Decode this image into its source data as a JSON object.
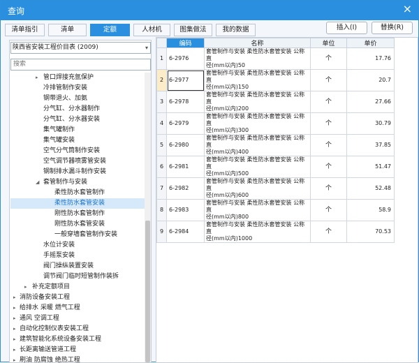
{
  "window": {
    "title": "查询",
    "close_glyph": "×"
  },
  "tabs": [
    {
      "label": "清单指引"
    },
    {
      "label": "清单"
    },
    {
      "label": "定额"
    },
    {
      "label": "人材机"
    },
    {
      "label": "图集做法"
    },
    {
      "label": "我的数据"
    }
  ],
  "active_tab": "定额",
  "buttons": {
    "insert": "插入(I)",
    "replace": "替换(R)"
  },
  "left": {
    "library_select": "陕西省安装工程价目表 (2009)",
    "search_placeholder": "搜索",
    "tree": [
      {
        "label": "管口焊接充氩保护",
        "level": 3,
        "expander": "▸"
      },
      {
        "label": "冷排管制作安装",
        "level": 3,
        "expander": ""
      },
      {
        "label": "钢带退火、加氨",
        "level": 3,
        "expander": ""
      },
      {
        "label": "分气缸、分水器制作",
        "level": 3,
        "expander": ""
      },
      {
        "label": "分气缸、分水器安装",
        "level": 3,
        "expander": ""
      },
      {
        "label": "集气罐制作",
        "level": 3,
        "expander": ""
      },
      {
        "label": "集气罐安装",
        "level": 3,
        "expander": ""
      },
      {
        "label": "空气分气筒制作安装",
        "level": 3,
        "expander": ""
      },
      {
        "label": "空气调节器喷雾管安装",
        "level": 3,
        "expander": ""
      },
      {
        "label": "钢制排水漏斗制作安装",
        "level": 3,
        "expander": ""
      },
      {
        "label": "套管制作与安装",
        "level": 3,
        "expander": "◢"
      },
      {
        "label": "柔性防水套管制作",
        "level": 4,
        "expander": ""
      },
      {
        "label": "柔性防水套管安装",
        "level": 4,
        "expander": "",
        "selected": true
      },
      {
        "label": "刚性防水套管制作",
        "level": 4,
        "expander": ""
      },
      {
        "label": "刚性防水套管安装",
        "level": 4,
        "expander": ""
      },
      {
        "label": "一般穿墙套管制作安装",
        "level": 4,
        "expander": ""
      },
      {
        "label": "水位计安装",
        "level": 3,
        "expander": ""
      },
      {
        "label": "手摇泵安装",
        "level": 3,
        "expander": ""
      },
      {
        "label": "阀门操纵装置安装",
        "level": 3,
        "expander": ""
      },
      {
        "label": "调节阀门临时短管制作装拆",
        "level": 3,
        "expander": ""
      },
      {
        "label": "补充定额项目",
        "level": 2,
        "expander": "▸"
      },
      {
        "label": "消防设备安装工程",
        "level": 1,
        "expander": "▸"
      },
      {
        "label": "给排水 采暖 燃气工程",
        "level": 1,
        "expander": "▸"
      },
      {
        "label": "通风 空调工程",
        "level": 1,
        "expander": "▸"
      },
      {
        "label": "自动化控制仪表安装工程",
        "level": 1,
        "expander": "▸"
      },
      {
        "label": "建筑智能化系统设备安装工程",
        "level": 1,
        "expander": "▸"
      },
      {
        "label": "长距离输送管道工程",
        "level": 1,
        "expander": "▸"
      },
      {
        "label": "刷油 防腐蚀 绝热工程",
        "level": 1,
        "expander": "▸"
      }
    ]
  },
  "grid": {
    "headers": {
      "idx": "",
      "code": "编码",
      "name": "名称",
      "unit": "单位",
      "price": "单价"
    },
    "rows": [
      {
        "idx": "1",
        "code": "6-2976",
        "name1": "套管制作与安装 柔性防水套管安装 公称直",
        "name2": "径(mm以内)50",
        "unit": "个",
        "price": "17.76"
      },
      {
        "idx": "2",
        "code": "6-2977",
        "name1": "套管制作与安装 柔性防水套管安装 公称直",
        "name2": "径(mm以内)150",
        "unit": "个",
        "price": "20.7",
        "selected": true
      },
      {
        "idx": "3",
        "code": "6-2978",
        "name1": "套管制作与安装 柔性防水套管安装 公称直",
        "name2": "径(mm以内)200",
        "unit": "个",
        "price": "27.66"
      },
      {
        "idx": "4",
        "code": "6-2979",
        "name1": "套管制作与安装 柔性防水套管安装 公称直",
        "name2": "径(mm以内)300",
        "unit": "个",
        "price": "30.79"
      },
      {
        "idx": "5",
        "code": "6-2980",
        "name1": "套管制作与安装 柔性防水套管安装 公称直",
        "name2": "径(mm以内)400",
        "unit": "个",
        "price": "37.85"
      },
      {
        "idx": "6",
        "code": "6-2981",
        "name1": "套管制作与安装 柔性防水套管安装 公称直",
        "name2": "径(mm以内)500",
        "unit": "个",
        "price": "51.47"
      },
      {
        "idx": "7",
        "code": "6-2982",
        "name1": "套管制作与安装 柔性防水套管安装 公称直",
        "name2": "径(mm以内)600",
        "unit": "个",
        "price": "52.48"
      },
      {
        "idx": "8",
        "code": "6-2983",
        "name1": "套管制作与安装 柔性防水套管安装 公称直",
        "name2": "径(mm以内)800",
        "unit": "个",
        "price": "58.9"
      },
      {
        "idx": "9",
        "code": "6-2984",
        "name1": "套管制作与安装 柔性防水套管安装 公称直",
        "name2": "径(mm以内)1000",
        "unit": "个",
        "price": "70.53"
      }
    ]
  },
  "colors": {
    "accent": "#2a8fdf",
    "selection": "#d6e9fb",
    "row_selected": "#fdecc8"
  }
}
